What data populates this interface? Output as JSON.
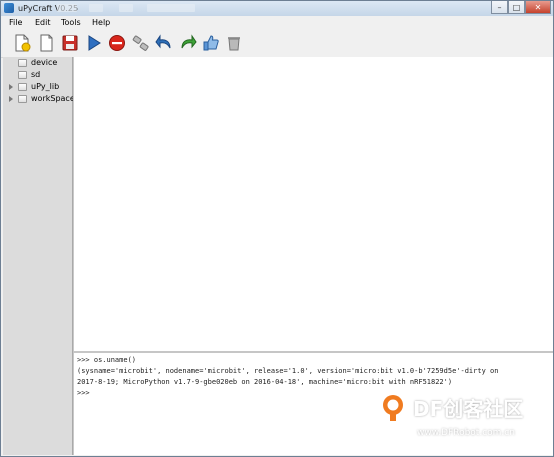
{
  "window": {
    "title": "uPyCraft V0.25"
  },
  "window_controls": {
    "minimize": "–",
    "maximize": "□",
    "close": "✕"
  },
  "menu": [
    "File",
    "Edit",
    "Tools",
    "Help"
  ],
  "toolbar": [
    {
      "name": "new-file",
      "icon": "new-file-icon"
    },
    {
      "name": "open-file",
      "icon": "open-file-icon"
    },
    {
      "name": "save",
      "icon": "save-icon"
    },
    {
      "name": "run",
      "icon": "run-icon"
    },
    {
      "name": "stop",
      "icon": "stop-icon"
    },
    {
      "name": "connect",
      "icon": "connect-icon"
    },
    {
      "name": "undo",
      "icon": "undo-icon"
    },
    {
      "name": "redo",
      "icon": "redo-icon"
    },
    {
      "name": "check-syntax",
      "icon": "thumbs-up-icon"
    },
    {
      "name": "clear",
      "icon": "trash-icon"
    }
  ],
  "tree": [
    {
      "label": "device",
      "expandable": false
    },
    {
      "label": "sd",
      "expandable": false
    },
    {
      "label": "uPy_lib",
      "expandable": true
    },
    {
      "label": "workSpace",
      "expandable": true
    }
  ],
  "console": [
    ">>> os.uname()",
    "(sysname='microbit', nodename='microbit', release='1.0', version='micro:bit v1.0-b'7259d5e'-dirty on",
    "2017-8-19; MicroPython v1.7-9-gbe020eb on 2016-04-18', machine='micro:bit with nRF51822')",
    ">>>"
  ],
  "watermark": {
    "name": "DF创客社区",
    "url": "www.DFRobot.com.cn"
  }
}
